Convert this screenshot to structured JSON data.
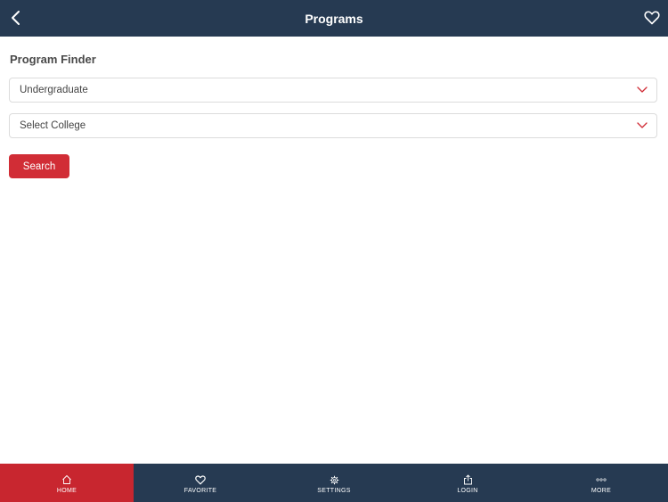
{
  "header": {
    "title": "Programs",
    "back_icon": "chevron-left-icon",
    "favorite_icon": "heart-outline-icon"
  },
  "finder": {
    "title": "Program Finder",
    "level_select": {
      "value": "Undergraduate"
    },
    "college_select": {
      "value": "Select College"
    },
    "search_label": "Search"
  },
  "colors": {
    "navy": "#263a52",
    "accent_red": "#d12d36",
    "active_tab": "#c8262f"
  },
  "tabbar": {
    "items": [
      {
        "label": "HOME",
        "icon": "home-icon",
        "active": true
      },
      {
        "label": "FAVORITE",
        "icon": "heart-icon",
        "active": false
      },
      {
        "label": "SETTINGS",
        "icon": "gear-icon",
        "active": false
      },
      {
        "label": "LOGIN",
        "icon": "share-icon",
        "active": false
      },
      {
        "label": "MORE",
        "icon": "more-dots-icon",
        "active": false
      }
    ]
  }
}
